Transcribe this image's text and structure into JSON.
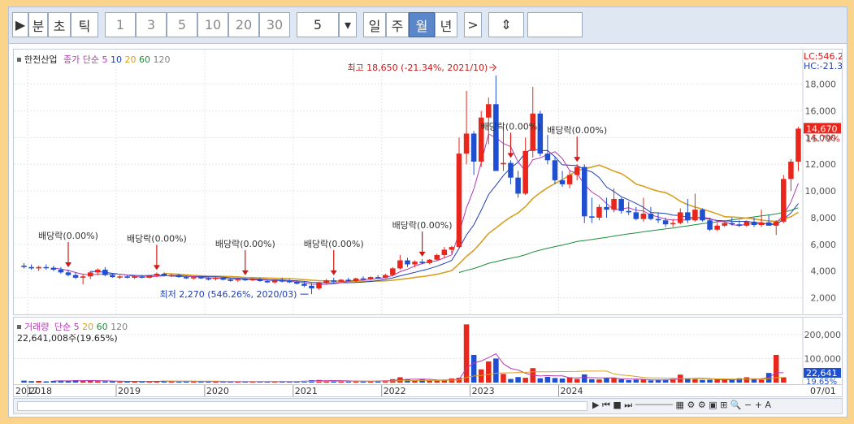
{
  "toolbar": {
    "buttons": [
      "▶",
      "분",
      "초",
      "틱",
      "1",
      "3",
      "5",
      "10",
      "20",
      "30",
      "5",
      "▾",
      "일",
      "주",
      "월",
      "년",
      ">",
      "⇕"
    ],
    "selected": "월"
  },
  "legend": {
    "stock": "한전산업",
    "ma_label": "종가 단순",
    "ma_periods": [
      "5",
      "10",
      "20",
      "60",
      "120"
    ],
    "ma_colors": [
      "#b33bb3",
      "#1f3fb5",
      "#d7a020",
      "#1e8c3a",
      "#808080"
    ]
  },
  "vol_legend": {
    "label": "거래량",
    "ma_label": "단순",
    "periods": [
      "5",
      "20",
      "60",
      "120"
    ],
    "value_text": "22,641,008주(19.65%)"
  },
  "annotations": {
    "high": "최고 18,650 (-21.34%, 2021/10)",
    "low": "최저 2,270 (546.26%, 2020/03)",
    "dividend": "배당락(0.00%)",
    "lc": "LC:546.2",
    "hc": "HC:-21.3",
    "last": "14,670",
    "pct": "15.79%",
    "vol_last": "22,641",
    "vol_pct": "19.65%"
  },
  "xaxis": {
    "years": [
      "2017",
      "2018",
      "2019",
      "2020",
      "2021",
      "2022",
      "2023",
      "2024"
    ],
    "end": "07/01"
  },
  "chart_data": {
    "type": "candlestick",
    "y_ticks": [
      2000,
      4000,
      6000,
      8000,
      10000,
      12000,
      14000,
      16000,
      18000
    ],
    "y_tick_labels": [
      "2,000",
      "4,000",
      "6,000",
      "8,000",
      "10,000",
      "12,000",
      "14,000",
      "16,000",
      "18,000"
    ],
    "vol_ticks": [
      100000,
      200000
    ],
    "vol_tick_labels": [
      "100,000",
      "200,000"
    ],
    "ylim": [
      1000,
      19500
    ],
    "start_month": "2017-12",
    "candles": [
      [
        4400,
        4600,
        4200,
        4300
      ],
      [
        4300,
        4500,
        4100,
        4200
      ],
      [
        4200,
        4400,
        4000,
        4300
      ],
      [
        4300,
        4500,
        4100,
        4250
      ],
      [
        4250,
        4400,
        4000,
        4100
      ],
      [
        4100,
        4300,
        3800,
        3900
      ],
      [
        3900,
        4100,
        3600,
        3700
      ],
      [
        3700,
        3900,
        3400,
        3500
      ],
      [
        3500,
        3800,
        3000,
        3600
      ],
      [
        3600,
        4000,
        3400,
        3900
      ],
      [
        3900,
        4200,
        3700,
        4100
      ],
      [
        4100,
        4300,
        3600,
        3700
      ],
      [
        3700,
        3800,
        3500,
        3550
      ],
      [
        3550,
        3700,
        3400,
        3600
      ],
      [
        3600,
        3700,
        3450,
        3500
      ],
      [
        3500,
        3650,
        3400,
        3600
      ],
      [
        3600,
        3700,
        3450,
        3500
      ],
      [
        3500,
        3700,
        3450,
        3650
      ],
      [
        3650,
        3900,
        3550,
        3800
      ],
      [
        3800,
        3900,
        3600,
        3650
      ],
      [
        3650,
        3800,
        3550,
        3700
      ],
      [
        3700,
        3800,
        3500,
        3550
      ],
      [
        3550,
        3650,
        3400,
        3450
      ],
      [
        3450,
        3600,
        3350,
        3550
      ],
      [
        3550,
        3650,
        3400,
        3450
      ],
      [
        3450,
        3550,
        3300,
        3400
      ],
      [
        3400,
        3550,
        3300,
        3500
      ],
      [
        3500,
        3550,
        3300,
        3350
      ],
      [
        3350,
        3450,
        3200,
        3300
      ],
      [
        3300,
        3450,
        3200,
        3400
      ],
      [
        3400,
        3500,
        3250,
        3350
      ],
      [
        3350,
        3450,
        3250,
        3400
      ],
      [
        3400,
        3500,
        3200,
        3250
      ],
      [
        3250,
        3350,
        3100,
        3150
      ],
      [
        3150,
        3400,
        3050,
        3300
      ],
      [
        3300,
        3500,
        3150,
        3250
      ],
      [
        3250,
        3400,
        3100,
        3200
      ],
      [
        3200,
        3300,
        3000,
        3050
      ],
      [
        3050,
        3200,
        2800,
        2900
      ],
      [
        2900,
        3100,
        2270,
        2700
      ],
      [
        2700,
        3200,
        2600,
        3100
      ],
      [
        3100,
        3400,
        3000,
        3300
      ],
      [
        3300,
        3500,
        3150,
        3200
      ],
      [
        3200,
        3400,
        3100,
        3350
      ],
      [
        3350,
        3500,
        3200,
        3250
      ],
      [
        3250,
        3500,
        3150,
        3450
      ],
      [
        3450,
        3600,
        3300,
        3400
      ],
      [
        3400,
        3600,
        3300,
        3550
      ],
      [
        3550,
        3700,
        3400,
        3500
      ],
      [
        3500,
        3800,
        3450,
        3700
      ],
      [
        3700,
        4300,
        3600,
        4200
      ],
      [
        4200,
        5200,
        4100,
        4800
      ],
      [
        4800,
        5000,
        4300,
        4500
      ],
      [
        4500,
        4800,
        4300,
        4700
      ],
      [
        4700,
        4900,
        4500,
        4600
      ],
      [
        4600,
        4900,
        4500,
        4850
      ],
      [
        4850,
        5300,
        4800,
        5200
      ],
      [
        5200,
        5800,
        5000,
        5600
      ],
      [
        5600,
        5900,
        5300,
        5800
      ],
      [
        5800,
        14000,
        5700,
        12800
      ],
      [
        12800,
        17500,
        12000,
        14300
      ],
      [
        14300,
        14500,
        11200,
        12200
      ],
      [
        12200,
        16000,
        11800,
        15500
      ],
      [
        15500,
        17000,
        13500,
        16500
      ],
      [
        16500,
        18650,
        11700,
        11500
      ],
      [
        12000,
        15000,
        11500,
        12100
      ],
      [
        12100,
        12300,
        10500,
        11000
      ],
      [
        11000,
        11500,
        9500,
        9800
      ],
      [
        9800,
        14000,
        9700,
        13000
      ],
      [
        13000,
        17800,
        12500,
        15800
      ],
      [
        15800,
        16000,
        12600,
        12800
      ],
      [
        12800,
        14200,
        12000,
        12300
      ],
      [
        12300,
        12500,
        10500,
        10800
      ],
      [
        10800,
        11500,
        10300,
        10500
      ],
      [
        10500,
        11500,
        10200,
        11200
      ],
      [
        11200,
        12000,
        10800,
        11800
      ],
      [
        11800,
        12000,
        7600,
        8100
      ],
      [
        8100,
        9500,
        7600,
        8000
      ],
      [
        8000,
        9000,
        7800,
        8800
      ],
      [
        8800,
        9500,
        8000,
        8600
      ],
      [
        8600,
        10200,
        8400,
        9400
      ],
      [
        9400,
        9500,
        8300,
        8500
      ],
      [
        8500,
        9200,
        8200,
        8400
      ],
      [
        8400,
        8800,
        7800,
        7900
      ],
      [
        7900,
        9500,
        7700,
        8300
      ],
      [
        8300,
        8800,
        7800,
        7900
      ],
      [
        7900,
        8400,
        7600,
        7800
      ],
      [
        7800,
        8000,
        7300,
        7500
      ],
      [
        7500,
        7900,
        7300,
        7600
      ],
      [
        7600,
        8700,
        7500,
        8400
      ],
      [
        8400,
        9400,
        7600,
        7800
      ],
      [
        7800,
        9800,
        7700,
        8600
      ],
      [
        8600,
        8700,
        7700,
        7800
      ],
      [
        7800,
        8000,
        7000,
        7100
      ],
      [
        7100,
        7600,
        7000,
        7400
      ],
      [
        7400,
        7800,
        7300,
        7600
      ],
      [
        7600,
        8000,
        7400,
        7500
      ],
      [
        7500,
        7800,
        7300,
        7400
      ],
      [
        7400,
        7800,
        7300,
        7700
      ],
      [
        7700,
        8000,
        7300,
        7450
      ],
      [
        7450,
        8600,
        7300,
        7650
      ],
      [
        7650,
        8200,
        7400,
        7400
      ],
      [
        7400,
        7800,
        6700,
        7700
      ],
      [
        7700,
        11200,
        7600,
        10900
      ],
      [
        10900,
        12400,
        10000,
        12200
      ],
      [
        12200,
        14800,
        11500,
        14670
      ]
    ],
    "volume": [
      8,
      6,
      7,
      5,
      7,
      9,
      8,
      10,
      7,
      9,
      6,
      5,
      5,
      4,
      5,
      6,
      4,
      5,
      6,
      7,
      5,
      4,
      5,
      6,
      4,
      4,
      5,
      3,
      4,
      5,
      4,
      5,
      3,
      4,
      5,
      6,
      4,
      5,
      7,
      10,
      11,
      8,
      6,
      5,
      6,
      7,
      5,
      6,
      8,
      9,
      14,
      22,
      14,
      10,
      13,
      9,
      8,
      12,
      17,
      20,
      242,
      115,
      55,
      88,
      100,
      36,
      15,
      23,
      20,
      60,
      18,
      24,
      19,
      17,
      22,
      15,
      34,
      14,
      13,
      20,
      18,
      14,
      10,
      12,
      13,
      9,
      10,
      12,
      15,
      33,
      15,
      14,
      11,
      12,
      13,
      11,
      12,
      18,
      22,
      15,
      12,
      40,
      115,
      22
    ],
    "dividends": [
      {
        "month": "2018-06"
      },
      {
        "month": "2019-06"
      },
      {
        "month": "2020-06"
      },
      {
        "month": "2021-06"
      },
      {
        "month": "2022-06"
      },
      {
        "month": "2023-06"
      },
      {
        "month": "2024-03"
      }
    ]
  }
}
